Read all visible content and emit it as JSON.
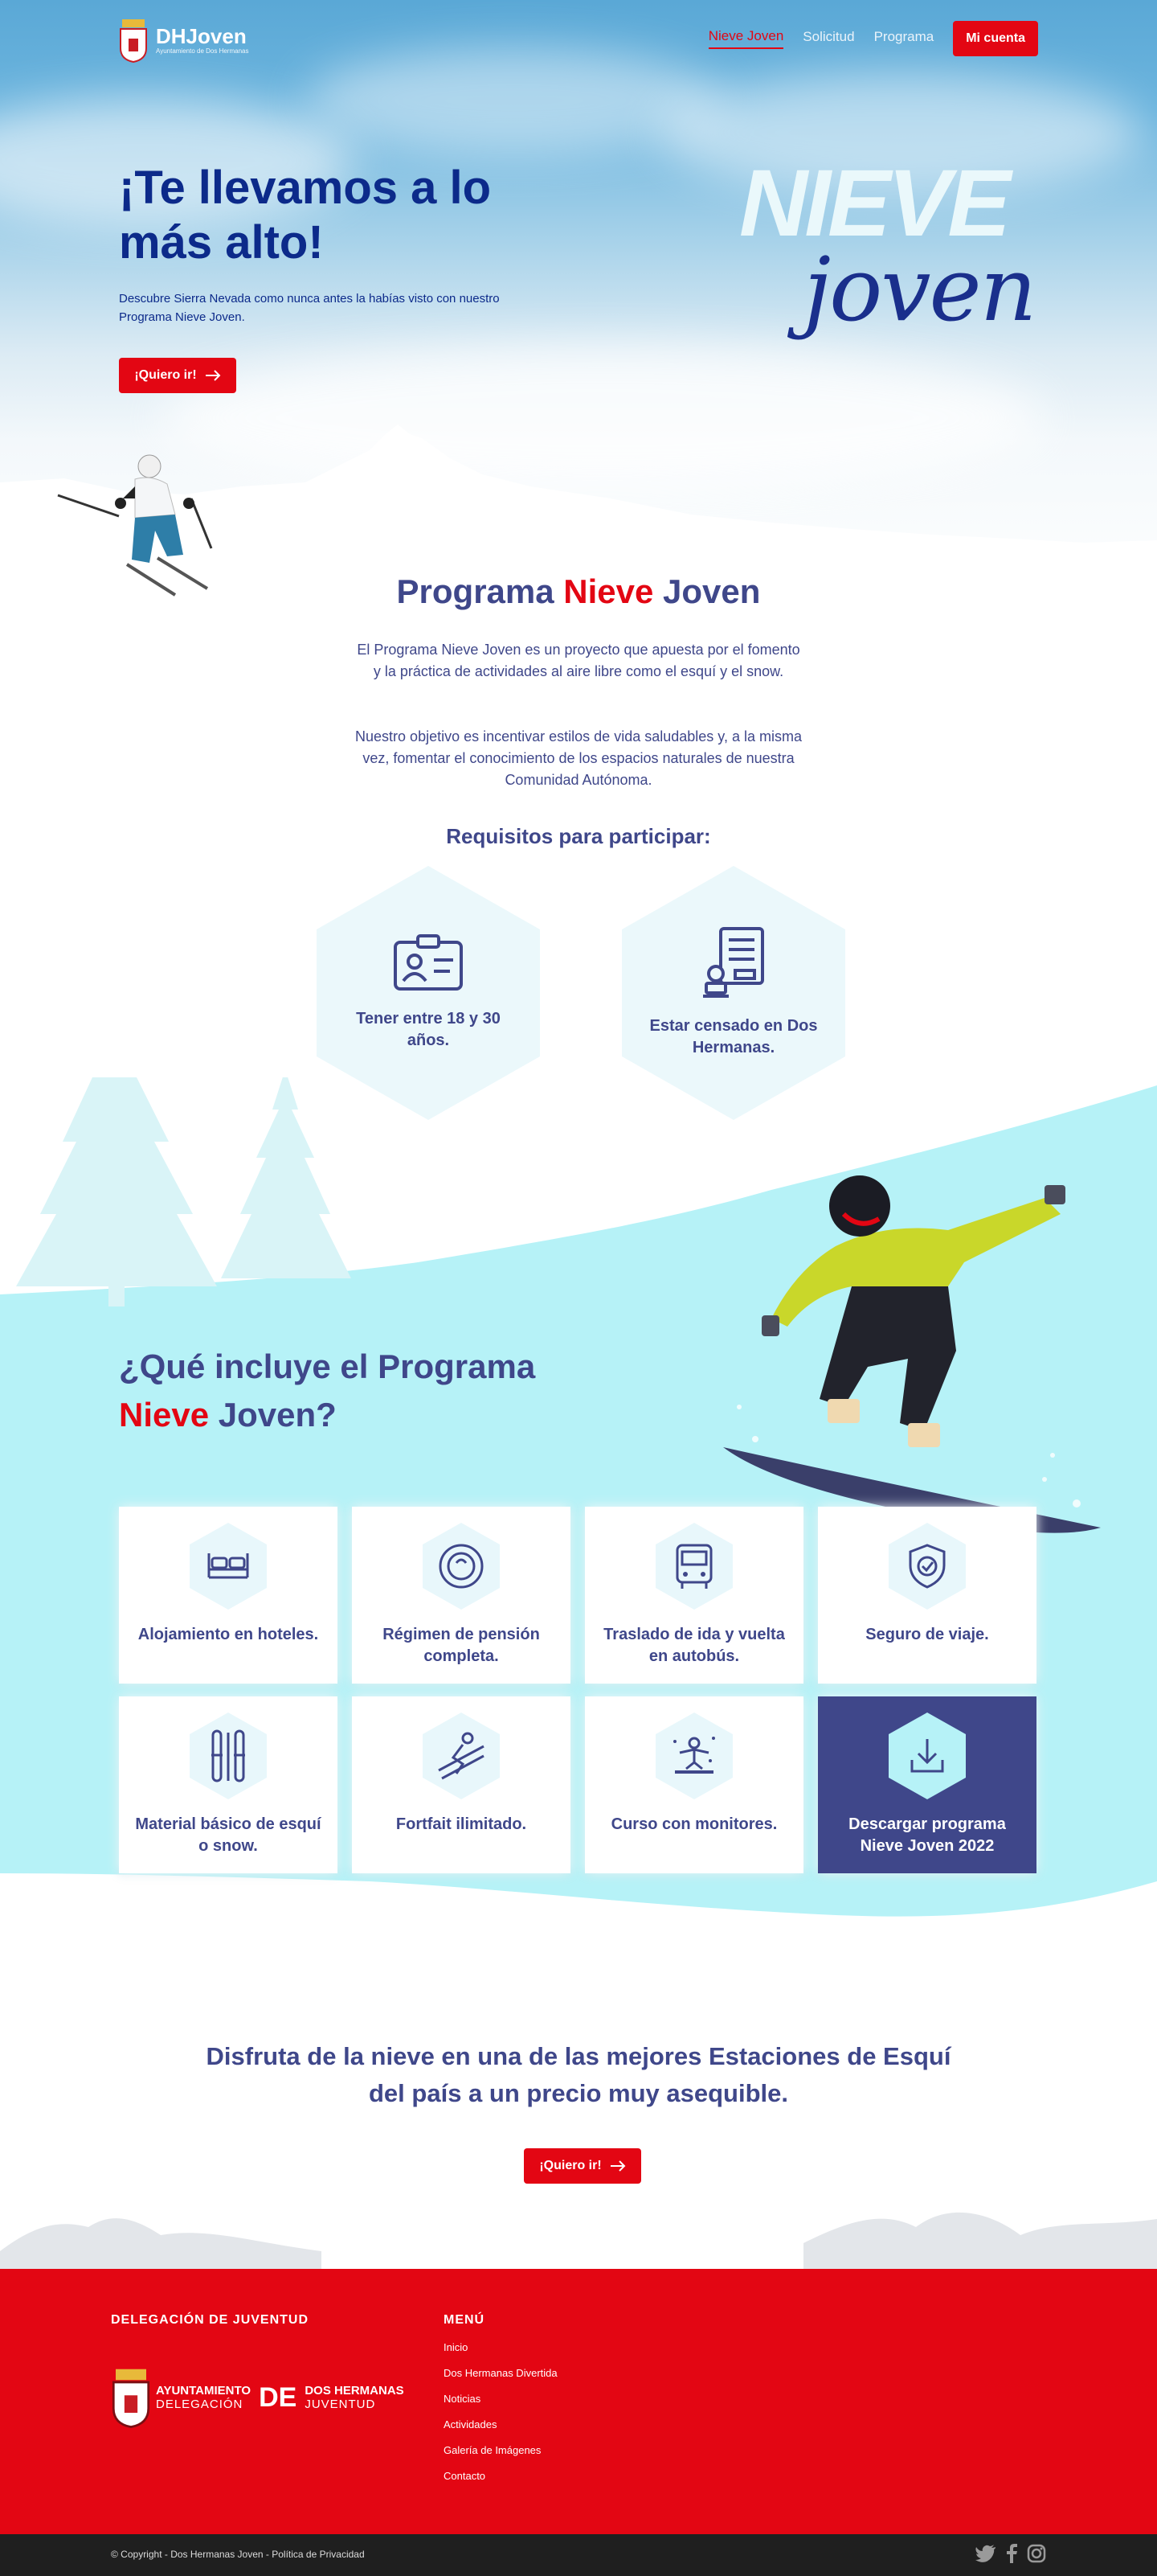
{
  "nav": {
    "logo_title": "DHJoven",
    "logo_subtitle": "Ayuntamiento de Dos Hermanas",
    "links": [
      "Nieve Joven",
      "Solicitud",
      "Programa"
    ],
    "account_button": "Mi cuenta"
  },
  "hero": {
    "title": "¡Te llevamos a lo más alto!",
    "description": "Descubre Sierra Nevada como nunca antes la habías visto con nuestro Programa Nieve Joven.",
    "cta": "¡Quiero ir!",
    "brand_top": "NIEVE",
    "brand_bottom": "joven"
  },
  "program": {
    "title_part1": "Programa ",
    "title_part2": "Nieve",
    "title_part3": " Joven",
    "paragraph1": "El Programa Nieve Joven es  un  proyecto que apuesta por el fomento y la práctica de actividades al aire libre como el esquí  y el snow.",
    "paragraph2": "Nuestro objetivo es incentivar estilos de vida saludables y, a la misma vez, fomentar el  conocimiento de los espacios naturales de nuestra Comunidad Autónoma."
  },
  "requirements": {
    "title": "Requisitos para participar:",
    "items": [
      {
        "icon": "id-card-icon",
        "text": "Tener entre 18 y 30 años."
      },
      {
        "icon": "certificate-stamp-icon",
        "text": "Estar censado en Dos Hermanas."
      }
    ]
  },
  "includes": {
    "title_part1": "¿Qué incluye el Programa ",
    "title_part2": "Nieve",
    "title_part3": " Joven?",
    "items": [
      {
        "icon": "bed-icon",
        "text": "Alojamiento en hoteles."
      },
      {
        "icon": "plate-icon",
        "text": "Régimen de pensión completa."
      },
      {
        "icon": "bus-icon",
        "text": "Traslado de ida y vuelta en autobús."
      },
      {
        "icon": "shield-check-icon",
        "text": "Seguro de viaje."
      },
      {
        "icon": "skis-icon",
        "text": "Material básico de esquí o snow."
      },
      {
        "icon": "skier-icon",
        "text": "Fortfait ilimitado."
      },
      {
        "icon": "snowboarder-icon",
        "text": "Curso con monitores."
      },
      {
        "icon": "download-icon",
        "text": "Descargar programa Nieve Joven 2022"
      }
    ]
  },
  "cta": {
    "title": "Disfruta de la nieve en una de las mejores Estaciones de Esquí del país a un precio muy asequible.",
    "button": "¡Quiero ir!"
  },
  "footer": {
    "col1_heading": "DELEGACIÓN DE JUVENTUD",
    "logo_line1": "AYUNTAMIENTO",
    "logo_line2": "DELEGACIÓN",
    "logo_de": "DE",
    "logo_line3": "DOS HERMANAS",
    "logo_line4": "JUVENTUD",
    "menu_heading": "MENÚ",
    "menu": [
      "Inicio",
      "Dos Hermanas Divertida",
      "Noticias",
      "Actividades",
      "Galería de Imágenes",
      "Contacto"
    ],
    "copyright": "© Copyright - Dos Hermanas Joven - ",
    "privacy": "Política de Privacidad"
  },
  "colors": {
    "primary": "#3f478a",
    "accent": "#e30613",
    "ice": "#b6f2f7",
    "navy": "#0c2a8a"
  }
}
